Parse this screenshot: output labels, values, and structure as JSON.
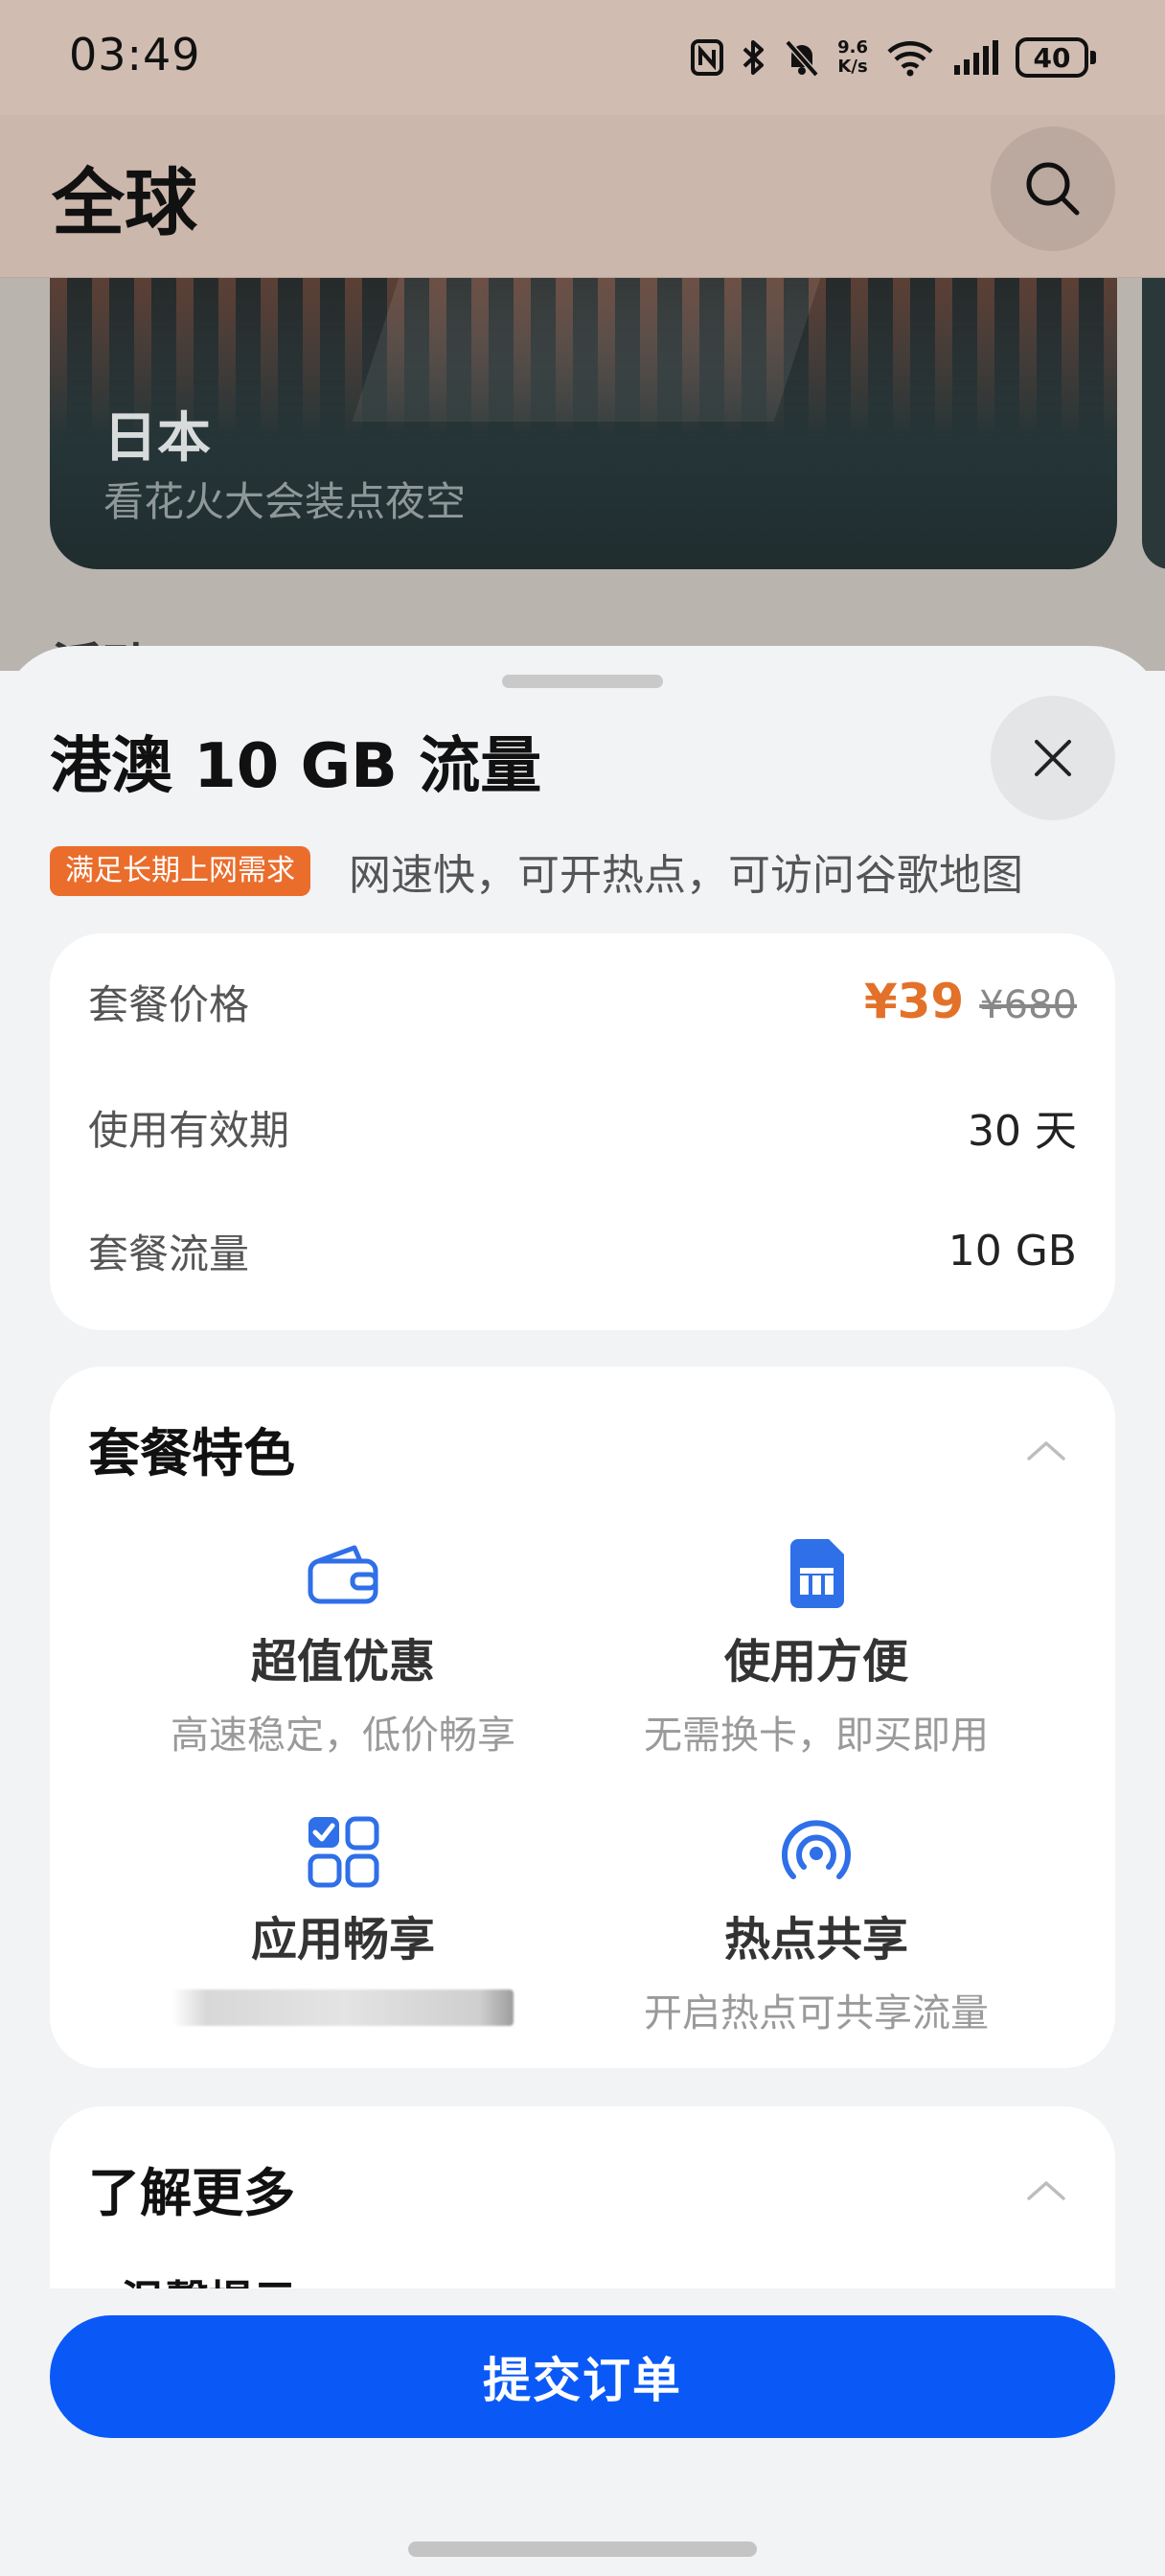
{
  "status_bar": {
    "time": "03:49",
    "speed_value": "9.6",
    "speed_unit": "K/s",
    "battery": "40"
  },
  "header": {
    "title": "全球"
  },
  "hero": {
    "country": "日本",
    "subtitle": "看花火大会装点夜空"
  },
  "background": {
    "section_peek": "活动"
  },
  "sheet": {
    "title": "港澳 10 GB 流量",
    "tag": "满足长期上网需求",
    "tag_description": "网速快，可开热点，可访问谷歌地图",
    "price_card": {
      "price_label": "套餐价格",
      "price_now": "¥39",
      "price_old": "¥680",
      "validity_label": "使用有效期",
      "validity_value": "30 天",
      "data_label": "套餐流量",
      "data_value": "10 GB"
    },
    "features": {
      "title": "套餐特色",
      "items": [
        {
          "name": "超值优惠",
          "desc": "高速稳定，低价畅享",
          "icon": "wallet-icon"
        },
        {
          "name": "使用方便",
          "desc": "无需换卡，即买即用",
          "icon": "sim-card-icon"
        },
        {
          "name": "应用畅享",
          "desc": "",
          "icon": "apps-grid-icon"
        },
        {
          "name": "热点共享",
          "desc": "开启热点可共享流量",
          "icon": "hotspot-icon"
        }
      ]
    },
    "learn_more": {
      "title": "了解更多",
      "first_item": "温馨提示"
    },
    "submit_label": "提交订单"
  },
  "colors": {
    "accent_blue": "#0a59f7",
    "price_orange": "#e3712a",
    "tag_orange": "#ea6d2c",
    "icon_blue": "#2f6fe8"
  }
}
